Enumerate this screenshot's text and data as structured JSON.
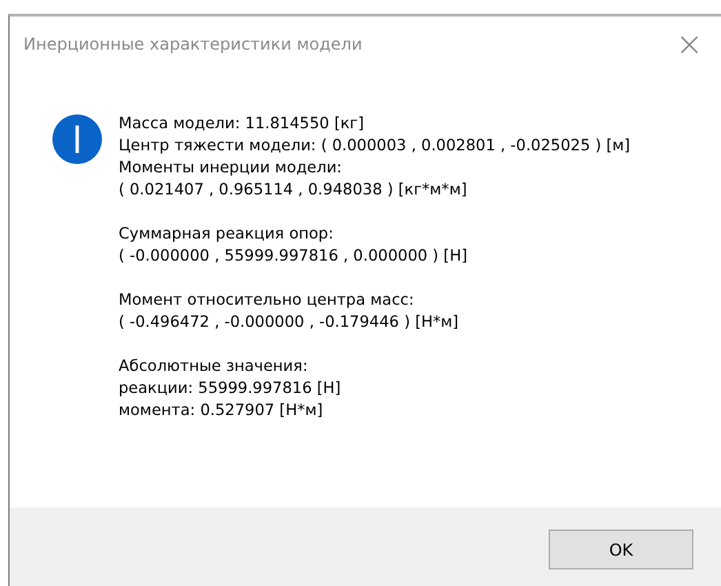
{
  "window": {
    "title": "Инерционные характеристики модели",
    "close": "×"
  },
  "message": [
    [
      "Масса модели: 11.814550 [кг]",
      "Центр тяжести модели: ( 0.000003 , 0.002801 , -0.025025 ) [м]",
      "Моменты инерции модели:",
      "( 0.021407 , 0.965114 , 0.948038 ) [кг*м*м]"
    ],
    [
      "Суммарная реакция опор:",
      "( -0.000000 , 55999.997816 , 0.000000 ) [Н]"
    ],
    [
      "Момент относительно центра масс:",
      "( -0.496472 , -0.000000 , -0.179446 ) [Н*м]"
    ],
    [
      "Абсолютные значения:",
      "реакции: 55999.997816 [Н]",
      "момента: 0.527907 [Н*м]"
    ]
  ],
  "buttons": [
    "OK"
  ]
}
